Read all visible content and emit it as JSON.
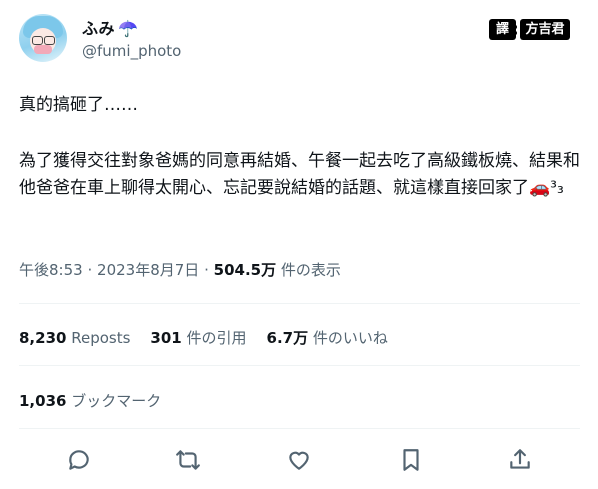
{
  "author": {
    "name": "ふみ",
    "name_emoji": "☂️",
    "handle": "@fumi_photo"
  },
  "watermark": {
    "part1": "譯",
    "part2": "方吉君"
  },
  "tweet": {
    "line1": "真的搞砸了……",
    "paragraph": "為了獲得交往對象爸媽的同意再結婚、午餐一起去吃了高級鐵板燒、結果和他爸爸在車上聊得太開心、忘記要說結婚的話題、就這樣直接回家了🚗³₃"
  },
  "meta": {
    "time": "午後8:53",
    "sep": "·",
    "date": "2023年8月7日",
    "views": "504.5万",
    "views_label": "件の表示"
  },
  "stats": {
    "reposts": "8,230",
    "reposts_label": "Reposts",
    "quotes": "301",
    "quotes_label": "件の引用",
    "likes": "6.7万",
    "likes_label": "件のいいね"
  },
  "bookmarks": {
    "count": "1,036",
    "label": "ブックマーク"
  },
  "actions": [
    "reply-icon",
    "repost-icon",
    "like-icon",
    "bookmark-icon",
    "share-icon"
  ]
}
